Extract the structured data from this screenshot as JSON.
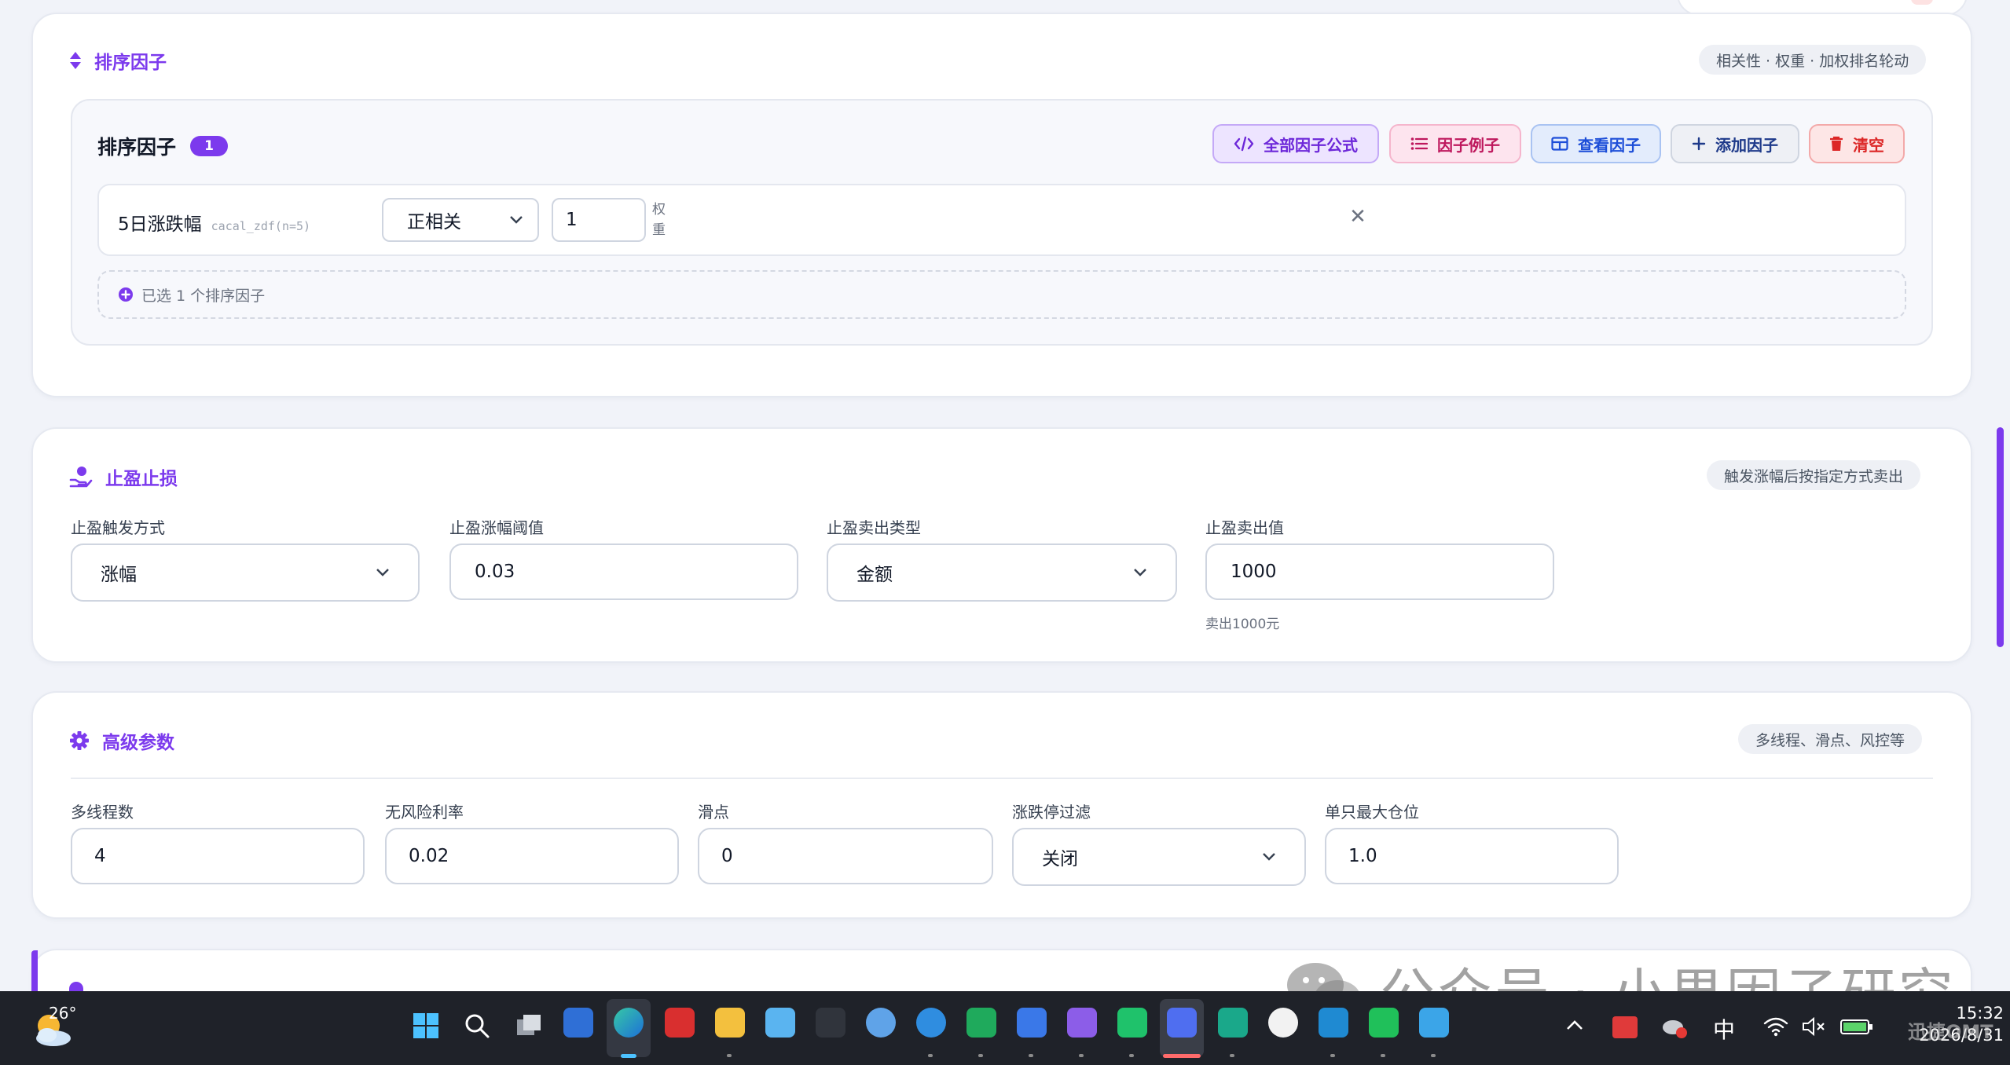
{
  "colors": {
    "accent": "#7c3aed",
    "page_bg": "#f1f3f9",
    "card_bg": "#ffffff",
    "taskbar": "#1f2229"
  },
  "rank_section": {
    "title": "排序因子",
    "hint": "相关性 · 权重 · 加权排名轮动",
    "panel_title": "排序因子",
    "count": "1",
    "buttons": {
      "all_formula": "全部因子公式",
      "examples": "因子例子",
      "view": "查看因子",
      "add": "添加因子",
      "clear": "清空"
    },
    "factor_row": {
      "name": "5日涨跌幅",
      "code": "cacal_zdf(n=5)",
      "relation": "正相关",
      "weight": "1",
      "weight_label_1": "权",
      "weight_label_2": "重",
      "remove_glyph": "✕"
    },
    "summary": "已选 1 个排序因子"
  },
  "take_profit": {
    "title": "止盈止损",
    "hint": "触发涨幅后按指定方式卖出",
    "trigger_label": "止盈触发方式",
    "trigger_value": "涨幅",
    "threshold_label": "止盈涨幅阈值",
    "threshold_value": "0.03",
    "sell_type_label": "止盈卖出类型",
    "sell_type_value": "金额",
    "sell_value_label": "止盈卖出值",
    "sell_value": "1000",
    "sell_value_help": "卖出1000元"
  },
  "advanced": {
    "title": "高级参数",
    "hint": "多线程、滑点、风控等",
    "threads_label": "多线程数",
    "threads_value": "4",
    "riskfree_label": "无风险利率",
    "riskfree_value": "0.02",
    "slippage_label": "滑点",
    "slippage_value": "0",
    "limit_label": "涨跌停过滤",
    "limit_value": "关闭",
    "maxpos_label": "单只最大仓位",
    "maxpos_value": "1.0"
  },
  "watermark": "公众号 · 小果因子研究",
  "taskbar": {
    "weather_temp": "26°",
    "ime": "中",
    "time": "15:32",
    "date": "2026/8/31",
    "corner_mark": "迅捷OMT"
  }
}
